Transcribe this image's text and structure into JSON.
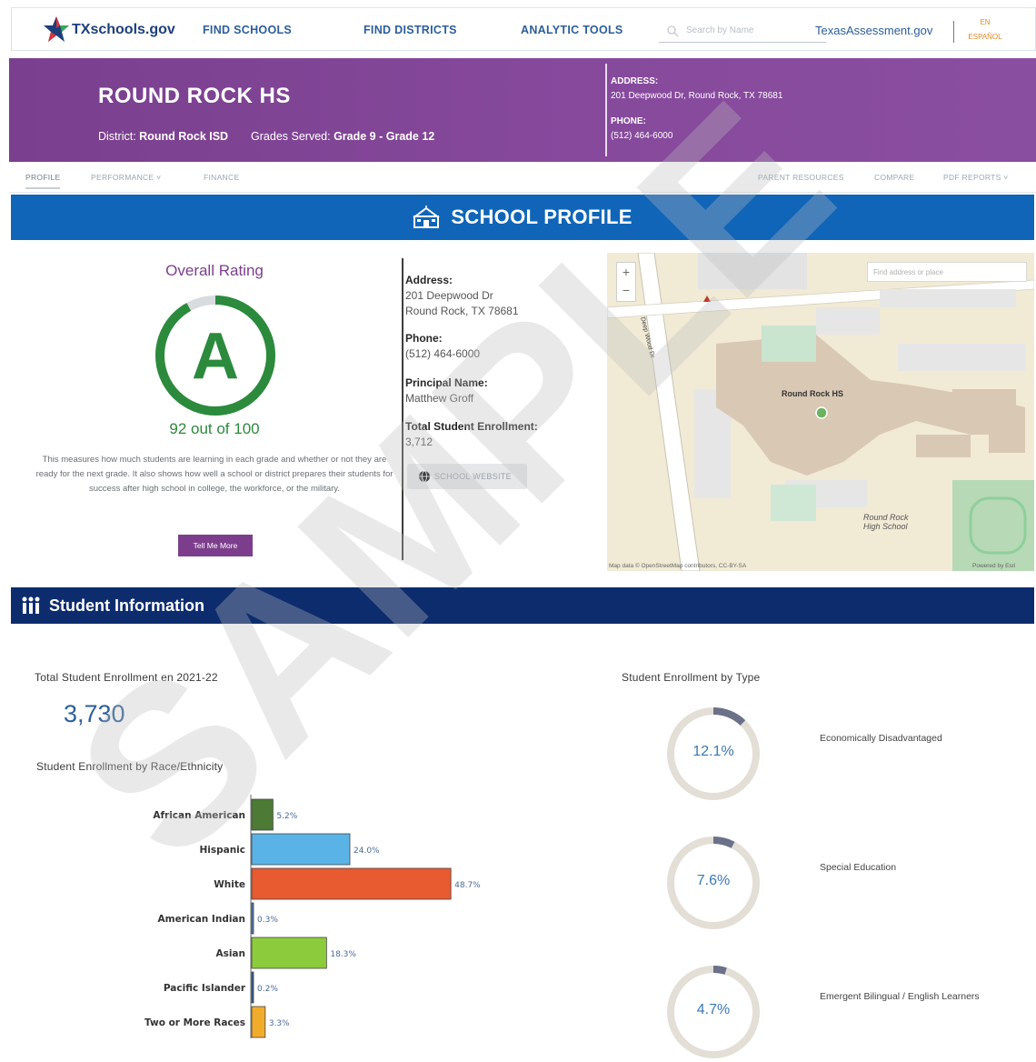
{
  "nav": {
    "logo_text": "TXschools.gov",
    "find_schools": "FIND SCHOOLS",
    "find_districts": "FIND DISTRICTS",
    "analytic_tools": "ANALYTIC TOOLS",
    "search_placeholder": "Search by Name",
    "assessment_link": "TexasAssessment.gov",
    "lang_en": "EN",
    "lang_es": "ESPAÑOL"
  },
  "hero": {
    "school_name": "ROUND ROCK HS",
    "district_label": "District:",
    "district_value": "Round Rock ISD",
    "grades_label": "Grades Served:",
    "grades_value": "Grade 9 - Grade 12",
    "address_label": "ADDRESS:",
    "address_value": "201 Deepwood Dr, Round Rock, TX 78681",
    "phone_label": "PHONE:",
    "phone_value": "(512) 464-6000"
  },
  "subnav": {
    "profile": "PROFILE",
    "performance": "PERFORMANCE ˅",
    "finance": "FINANCE",
    "parent_resources": "PARENT RESOURCES",
    "compare": "COMPARE",
    "pdf_reports": "PDF REPORTS ˅"
  },
  "profile": {
    "banner_title": "SCHOOL PROFILE",
    "rating_title": "Overall Rating",
    "rating_letter": "A",
    "rating_score_text": "92 out of 100",
    "rating_score": 92,
    "rating_max": 100,
    "rating_desc": "This measures how much students are learning in each grade and whether or not they are ready for the next grade. It also shows how well a school or district prepares their students for success after high school in college, the workforce, or the military.",
    "tell_more": "Tell Me More",
    "address_label": "Address:",
    "address_line1": "201 Deepwood Dr",
    "address_line2": "Round Rock, TX 78681",
    "phone_label": "Phone:",
    "phone_value": "(512) 464-6000",
    "principal_label": "Principal Name:",
    "principal_value": "Matthew Groff",
    "enrollment_label": "Total Student Enrollment:",
    "enrollment_value": "3,712",
    "website_button": "SCHOOL WEBSITE"
  },
  "map": {
    "search_placeholder": "Find address or place",
    "zoom_in": "+",
    "zoom_out": "−",
    "school_label": "Round Rock HS",
    "road_label": "Deep Wood Dr",
    "campus_label": "Round Rock High School",
    "credit_left": "Map data © OpenStreetMap contributors, CC-BY-SA",
    "credit_right": "Powered by Esri"
  },
  "student_info": {
    "banner_title": "Student Information",
    "enrollment_label": "Total Student Enrollment en 2021-22",
    "enrollment_total": "3,730",
    "race_label": "Student Enrollment by Race/Ethnicity",
    "type_label": "Student Enrollment by Type",
    "types": [
      {
        "label": "Economically Disadvantaged",
        "value_text": "12.1%",
        "value": 12.1
      },
      {
        "label": "Special Education",
        "value_text": "7.6%",
        "value": 7.6
      },
      {
        "label": "Emergent Bilingual / English Learners",
        "value_text": "4.7%",
        "value": 4.7
      }
    ]
  },
  "chart_data": {
    "type": "bar",
    "orientation": "horizontal",
    "title": "Student Enrollment by Race/Ethnicity",
    "categories": [
      "African American",
      "Hispanic",
      "White",
      "American Indian",
      "Asian",
      "Pacific Islander",
      "Two or More Races"
    ],
    "values": [
      5.2,
      24.0,
      48.7,
      0.3,
      18.3,
      0.2,
      3.3
    ],
    "value_labels": [
      "5.2%",
      "24.0%",
      "48.7%",
      "0.3%",
      "18.3%",
      "0.2%",
      "3.3%"
    ],
    "colors": [
      "#4d7a35",
      "#5ab3e6",
      "#e85a30",
      "#4a7fbf",
      "#8ccc3c",
      "#2d5f9a",
      "#f2ac2c"
    ]
  },
  "colors": {
    "hero_purple": "#7f4393",
    "profile_blue": "#1065b8",
    "student_navy": "#0d2c6e",
    "rating_green": "#2c8a3c"
  },
  "watermark": "SAMPLE"
}
